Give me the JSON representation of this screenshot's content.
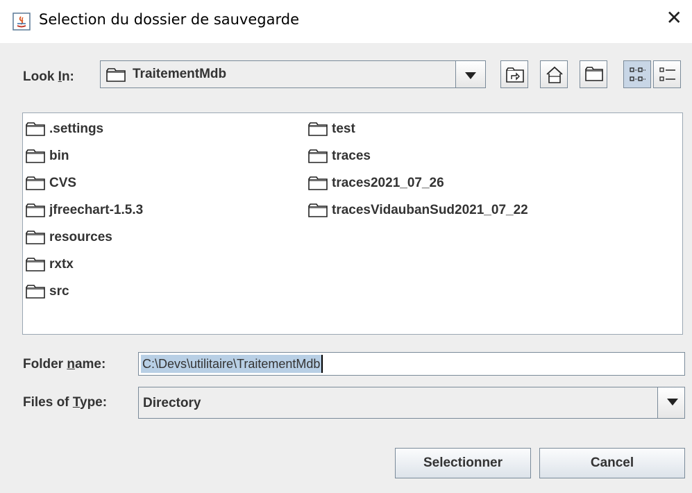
{
  "window": {
    "title": "Selection du dossier de sauvegarde",
    "close_symbol": "✕"
  },
  "look_in": {
    "label_pre": "Look ",
    "label_mnemonic": "I",
    "label_post": "n:",
    "value": "TraitementMdb"
  },
  "toolbar": {
    "icons": [
      "up-folder-icon",
      "home-icon",
      "new-folder-icon",
      "list-view-icon",
      "details-view-icon"
    ]
  },
  "files": {
    "column1": [
      ".settings",
      "bin",
      "CVS",
      "jfreechart-1.5.3",
      "resources",
      "rxtx",
      "src"
    ],
    "column2": [
      "test",
      "traces",
      "traces2021_07_26",
      "tracesVidaubanSud2021_07_22"
    ]
  },
  "folder_name": {
    "label_pre": "Folder ",
    "label_mnemonic": "n",
    "label_post": "ame:",
    "value": "C:\\Devs\\utilitaire\\TraitementMdb"
  },
  "files_of_type": {
    "label_pre": "Files of ",
    "label_mnemonic": "T",
    "label_post": "ype:",
    "value": "Directory"
  },
  "buttons": {
    "select": "Selectionner",
    "cancel": "Cancel"
  },
  "colors": {
    "background": "#eeeeee",
    "selection": "#b8cfe5",
    "border": "#7a8a99"
  }
}
